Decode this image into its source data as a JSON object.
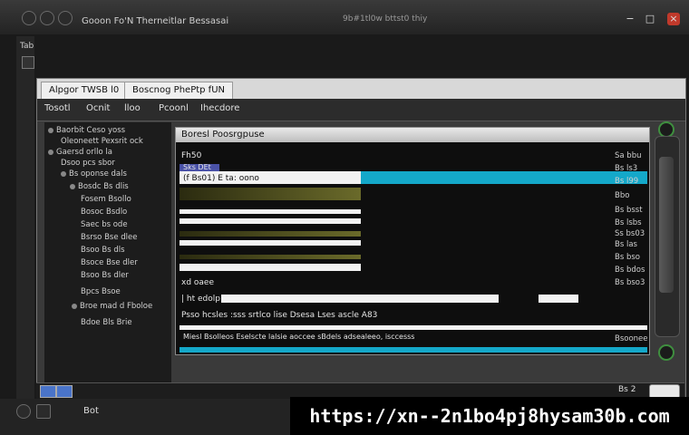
{
  "titlebar": {
    "title": "Gooon Fo'N Therneitlar Bessasai",
    "center_text": "9b#1tl0w bttst0 thiy",
    "buttons": [
      "min",
      "max",
      "close"
    ]
  },
  "left_panel": {
    "label": "Tab"
  },
  "tabs": [
    {
      "label": "Alpgor TWSB  l0"
    },
    {
      "label": "Boscnog PhePtp fUN"
    }
  ],
  "toolbar": {
    "items": [
      "Tosotl",
      "Ocnit",
      "lloo",
      "Pcoonl",
      "Ihecdore"
    ]
  },
  "tree": {
    "items": [
      "Baorbit Ceso yoss",
      "Oleoneett Pexsrit ock",
      "Gaersd orllo la",
      "Dsoo pcs sbor",
      "Bs oponse dals",
      "Bosdc Bs dlis",
      "Fosem Bsollo",
      "Bosoc Bsdlo",
      "Saec bs ode",
      "Bsrso Bse dlee",
      "Bsoo Bs dls",
      "Bsoce Bse dler",
      "Bsoo Bs dler",
      "Bpcs Bsoe",
      "Broe mad d Fboloe",
      "Bdoe Bls Brie"
    ]
  },
  "dialog": {
    "title": "Boresl Poosrgpuse",
    "row_labels": [
      "Fh50",
      "Sks DEt",
      "(f Bs01) E  ta: oono",
      "xd oaee",
      "| ht edolp",
      "Psso  hcsles  :sss  srtlco  lise  Dsesa  Lses ascle  A83",
      "Miesl Bsolleos Eselscte lalsie aoccee sBdels adsealeeo, isccesss"
    ],
    "right_column": [
      "Sa bbu",
      "Bs ls3",
      "Bs l99",
      "Bbo",
      "Bs bsst",
      "Bs lsbs",
      "Ss bs03",
      "Bs las",
      "Bs bso",
      "Bs bdos",
      "Bs bso3",
      "Bsoonee"
    ]
  },
  "status": {
    "right_text": "Bs 2"
  },
  "bottom": {
    "text": "Bot",
    "url": "https://xn--2n1bo4pj8hysam30b.com"
  },
  "colors": {
    "teal": "#14a8c9",
    "blue": "#4a52a8",
    "green_ring": "#3f8f3f"
  }
}
